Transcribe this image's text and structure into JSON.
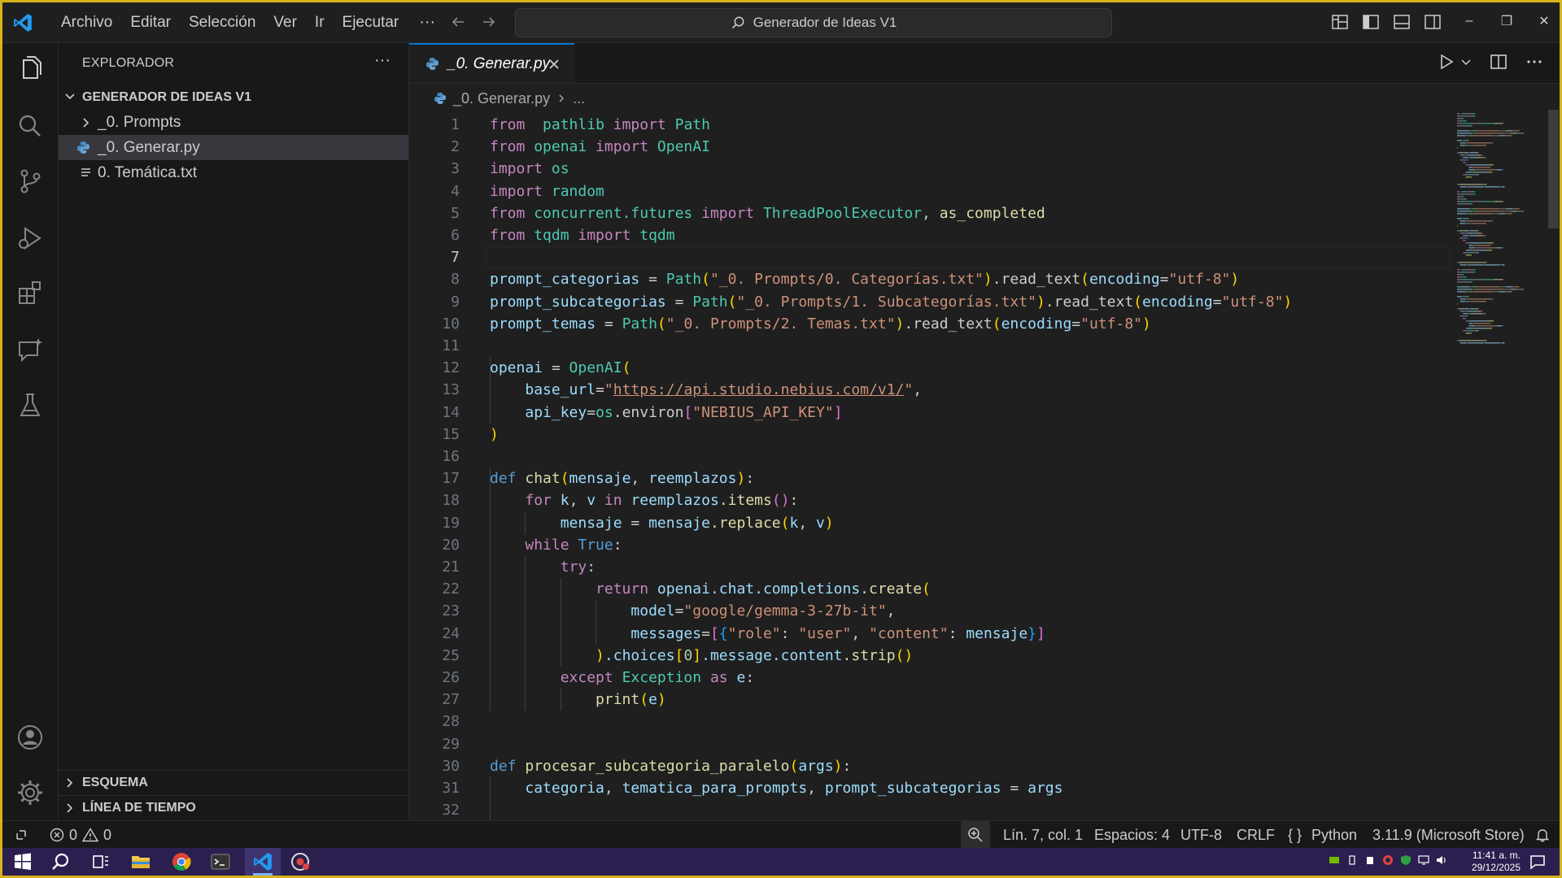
{
  "titlebar": {
    "menu": [
      "Archivo",
      "Editar",
      "Selección",
      "Ver",
      "Ir",
      "Ejecutar"
    ],
    "more": "···",
    "search_text": "Generador de Ideas V1",
    "window_controls": [
      "–",
      "❐",
      "✕"
    ]
  },
  "sidebar": {
    "title": "EXPLORADOR",
    "more": "···",
    "folder": "GENERADOR DE IDEAS V1",
    "items": [
      {
        "label": "_0. Prompts",
        "icon": "chevron-right-icon"
      },
      {
        "label": "_0. Generar.py",
        "icon": "python-icon"
      },
      {
        "label": "0. Temática.txt",
        "icon": "text-file-icon"
      }
    ],
    "outline": "ESQUEMA",
    "timeline": "LÍNEA DE TIEMPO"
  },
  "editor": {
    "tab_label": "_0. Generar.py",
    "breadcrumb_file": "_0. Generar.py",
    "breadcrumb_more": "...",
    "active_line": 7,
    "lines": [
      [
        [
          "kw",
          "from"
        ],
        [
          "",
          "  "
        ],
        [
          "cl",
          "pathlib"
        ],
        [
          "",
          ""
        ],
        [
          "kw",
          " import"
        ],
        [
          "cl",
          " Path"
        ]
      ],
      [
        [
          "kw",
          "from"
        ],
        [
          "cl",
          " openai"
        ],
        [
          "kw",
          " import"
        ],
        [
          "cl",
          " OpenAI"
        ]
      ],
      [
        [
          "kw",
          "import"
        ],
        [
          "cl",
          " os"
        ]
      ],
      [
        [
          "kw",
          "import"
        ],
        [
          "cl",
          " random"
        ]
      ],
      [
        [
          "kw",
          "from"
        ],
        [
          "cl",
          " concurrent.futures"
        ],
        [
          "kw",
          " import"
        ],
        [
          "cl",
          " ThreadPoolExecutor"
        ],
        [
          "",
          ","
        ],
        [
          "fn",
          " as_completed"
        ]
      ],
      [
        [
          "kw",
          "from"
        ],
        [
          "cl",
          " tqdm"
        ],
        [
          "kw",
          " import"
        ],
        [
          "cl",
          " tqdm"
        ]
      ],
      [],
      [
        [
          "va",
          "prompt_categorias"
        ],
        [
          "",
          " = "
        ],
        [
          "cl",
          "Path"
        ],
        [
          "b1",
          "("
        ],
        [
          "st",
          "\"_0. Prompts/0. Categorías.txt\""
        ],
        [
          "b1",
          ")"
        ],
        [
          "",
          ".read_text"
        ],
        [
          "b1",
          "("
        ],
        [
          "va",
          "encoding"
        ],
        [
          "",
          "="
        ],
        [
          "st",
          "\"utf-8\""
        ],
        [
          "b1",
          ")"
        ]
      ],
      [
        [
          "va",
          "prompt_subcategorias"
        ],
        [
          "",
          " = "
        ],
        [
          "cl",
          "Path"
        ],
        [
          "b1",
          "("
        ],
        [
          "st",
          "\"_0. Prompts/1. Subcategorías.txt\""
        ],
        [
          "b1",
          ")"
        ],
        [
          "",
          ".read_text"
        ],
        [
          "b1",
          "("
        ],
        [
          "va",
          "encoding"
        ],
        [
          "",
          "="
        ],
        [
          "st",
          "\"utf-8\""
        ],
        [
          "b1",
          ")"
        ]
      ],
      [
        [
          "va",
          "prompt_temas"
        ],
        [
          "",
          " = "
        ],
        [
          "cl",
          "Path"
        ],
        [
          "b1",
          "("
        ],
        [
          "st",
          "\"_0. Prompts/2. Temas.txt\""
        ],
        [
          "b1",
          ")"
        ],
        [
          "",
          ".read_text"
        ],
        [
          "b1",
          "("
        ],
        [
          "va",
          "encoding"
        ],
        [
          "",
          "="
        ],
        [
          "st",
          "\"utf-8\""
        ],
        [
          "b1",
          ")"
        ]
      ],
      [],
      [
        [
          "va",
          "openai"
        ],
        [
          "",
          " = "
        ],
        [
          "cl",
          "OpenAI"
        ],
        [
          "b1",
          "("
        ]
      ],
      [
        [
          "",
          "    "
        ],
        [
          "va",
          "base_url"
        ],
        [
          "",
          "="
        ],
        [
          "st",
          "\""
        ],
        [
          "url",
          "https://api.studio.nebius.com/v1/"
        ],
        [
          "st",
          "\""
        ],
        [
          "",
          ","
        ]
      ],
      [
        [
          "",
          "    "
        ],
        [
          "va",
          "api_key"
        ],
        [
          "",
          "="
        ],
        [
          "cl",
          "os"
        ],
        [
          "",
          ".environ"
        ],
        [
          "b2",
          "["
        ],
        [
          "st",
          "\"NEBIUS_API_KEY\""
        ],
        [
          "b2",
          "]"
        ]
      ],
      [
        [
          "b1",
          ")"
        ]
      ],
      [],
      [
        [
          "kb",
          "def"
        ],
        [
          "fn",
          " chat"
        ],
        [
          "b1",
          "("
        ],
        [
          "va",
          "mensaje"
        ],
        [
          "",
          ", "
        ],
        [
          "va",
          "reemplazos"
        ],
        [
          "b1",
          ")"
        ],
        [
          "",
          ":"
        ]
      ],
      [
        [
          "",
          "    "
        ],
        [
          "kw",
          "for"
        ],
        [
          "va",
          " k"
        ],
        [
          "",
          ", "
        ],
        [
          "va",
          "v"
        ],
        [
          "kw",
          " in"
        ],
        [
          "va",
          " reemplazos"
        ],
        [
          "fn",
          ".items"
        ],
        [
          "b2",
          "()"
        ],
        [
          "",
          ":"
        ]
      ],
      [
        [
          "",
          "        "
        ],
        [
          "va",
          "mensaje"
        ],
        [
          "",
          " = "
        ],
        [
          "va",
          "mensaje"
        ],
        [
          "fn",
          ".replace"
        ],
        [
          "b1",
          "("
        ],
        [
          "va",
          "k"
        ],
        [
          "",
          ", "
        ],
        [
          "va",
          "v"
        ],
        [
          "b1",
          ")"
        ]
      ],
      [
        [
          "",
          "    "
        ],
        [
          "kw",
          "while"
        ],
        [
          "kb",
          " True"
        ],
        [
          "",
          ":"
        ]
      ],
      [
        [
          "",
          "        "
        ],
        [
          "kw",
          "try"
        ],
        [
          "",
          ":"
        ]
      ],
      [
        [
          "",
          "            "
        ],
        [
          "kw",
          "return"
        ],
        [
          "va",
          " openai"
        ],
        [
          "va",
          ".chat"
        ],
        [
          "va",
          ".completions"
        ],
        [
          "fn",
          ".create"
        ],
        [
          "b1",
          "("
        ]
      ],
      [
        [
          "",
          "                "
        ],
        [
          "va",
          "model"
        ],
        [
          "",
          "="
        ],
        [
          "st",
          "\"google/gemma-3-27b-it\""
        ],
        [
          "",
          ","
        ]
      ],
      [
        [
          "",
          "                "
        ],
        [
          "va",
          "messages"
        ],
        [
          "",
          "="
        ],
        [
          "b2",
          "["
        ],
        [
          "b3",
          "{"
        ],
        [
          "st",
          "\"role\""
        ],
        [
          "",
          ": "
        ],
        [
          "st",
          "\"user\""
        ],
        [
          "",
          ", "
        ],
        [
          "st",
          "\"content\""
        ],
        [
          "",
          ": "
        ],
        [
          "va",
          "mensaje"
        ],
        [
          "b3",
          "}"
        ],
        [
          "b2",
          "]"
        ]
      ],
      [
        [
          "",
          "            "
        ],
        [
          "b1",
          ")"
        ],
        [
          "va",
          ".choices"
        ],
        [
          "b1",
          "["
        ],
        [
          "nu",
          "0"
        ],
        [
          "b1",
          "]"
        ],
        [
          "va",
          ".message"
        ],
        [
          "va",
          ".content"
        ],
        [
          "fn",
          ".strip"
        ],
        [
          "b1",
          "()"
        ]
      ],
      [
        [
          "",
          "        "
        ],
        [
          "kw",
          "except"
        ],
        [
          "cl",
          " Exception"
        ],
        [
          "kw",
          " as"
        ],
        [
          "va",
          " e"
        ],
        [
          "",
          ":"
        ]
      ],
      [
        [
          "",
          "            "
        ],
        [
          "fn",
          "print"
        ],
        [
          "b1",
          "("
        ],
        [
          "va",
          "e"
        ],
        [
          "b1",
          ")"
        ]
      ],
      [],
      [],
      [
        [
          "kb",
          "def"
        ],
        [
          "fn",
          " procesar_subcategoria_paralelo"
        ],
        [
          "b1",
          "("
        ],
        [
          "va",
          "args"
        ],
        [
          "b1",
          ")"
        ],
        [
          "",
          ":"
        ]
      ],
      [
        [
          "",
          "    "
        ],
        [
          "va",
          "categoria"
        ],
        [
          "",
          ", "
        ],
        [
          "va",
          "tematica_para_prompts"
        ],
        [
          "",
          ", "
        ],
        [
          "va",
          "prompt_subcategorias"
        ],
        [
          "",
          " = "
        ],
        [
          "va",
          "args"
        ]
      ],
      []
    ]
  },
  "status": {
    "errors": "0",
    "warnings": "0",
    "position": "Lín. 7, col. 1",
    "spaces": "Espacios: 4",
    "encoding": "UTF-8",
    "eol": "CRLF",
    "language_braces": "{ }",
    "language": "Python",
    "interpreter": "3.11.9 (Microsoft Store)"
  },
  "taskbar": {
    "time": "11:41 a. m.",
    "date": "29/12/2025"
  },
  "colors": {
    "accent": "#0078d4",
    "taskbar": "#2b1f4f",
    "border": "#d6b31a"
  }
}
